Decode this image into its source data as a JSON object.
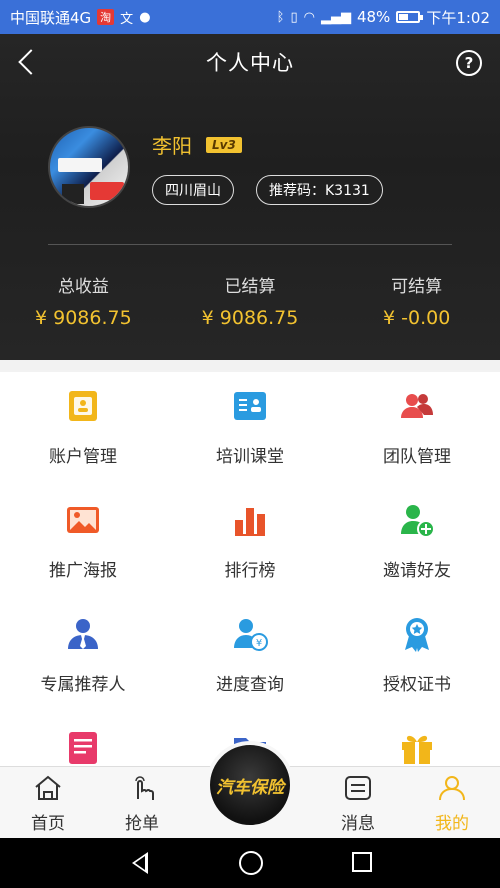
{
  "status_bar": {
    "carrier": "中国联通4G",
    "app_badge": "淘",
    "extra_icons": [
      "文",
      "●"
    ],
    "battery": "48%",
    "battery_level": 0.48,
    "time": "下午1:02"
  },
  "header": {
    "title": "个人中心",
    "help_label": "?"
  },
  "profile": {
    "name": "李阳",
    "level": "Lv3",
    "location": "四川眉山",
    "referral_code": "推荐码：K3131"
  },
  "stats": [
    {
      "label": "总收益",
      "value": "¥ 9086.75"
    },
    {
      "label": "已结算",
      "value": "¥ 9086.75"
    },
    {
      "label": "可结算",
      "value": "¥ -0.00"
    }
  ],
  "grid": [
    {
      "label": "账户管理",
      "icon": "account-icon",
      "color": "#f2b61a"
    },
    {
      "label": "培训课堂",
      "icon": "training-icon",
      "color": "#2a9be0"
    },
    {
      "label": "团队管理",
      "icon": "team-icon",
      "color": "#e84d4d"
    },
    {
      "label": "推广海报",
      "icon": "poster-icon",
      "color": "#f05a28"
    },
    {
      "label": "排行榜",
      "icon": "ranking-icon",
      "color": "#e8542a"
    },
    {
      "label": "邀请好友",
      "icon": "invite-icon",
      "color": "#2ab54a"
    },
    {
      "label": "专属推荐人",
      "icon": "referrer-icon",
      "color": "#3b64c8"
    },
    {
      "label": "进度查询",
      "icon": "progress-icon",
      "color": "#2a9be0"
    },
    {
      "label": "授权证书",
      "icon": "certificate-icon",
      "color": "#2a9be0"
    },
    {
      "label": "",
      "icon": "document-icon",
      "color": "#e83a6a"
    },
    {
      "label": "",
      "icon": "folder-icon",
      "color": "#3b64c8"
    },
    {
      "label": "",
      "icon": "gift-icon",
      "color": "#f2b61a"
    }
  ],
  "tabbar": {
    "tabs": [
      {
        "label": "首页",
        "icon": "home-icon"
      },
      {
        "label": "抢单",
        "icon": "grab-order-icon"
      },
      {
        "label": "消息",
        "icon": "message-icon"
      },
      {
        "label": "我的",
        "icon": "profile-icon",
        "active": true
      }
    ],
    "center_logo": "汽车保险"
  },
  "colors": {
    "accent": "#f2c230",
    "header_bg": "#222222",
    "active_tab": "#f2b61a"
  }
}
